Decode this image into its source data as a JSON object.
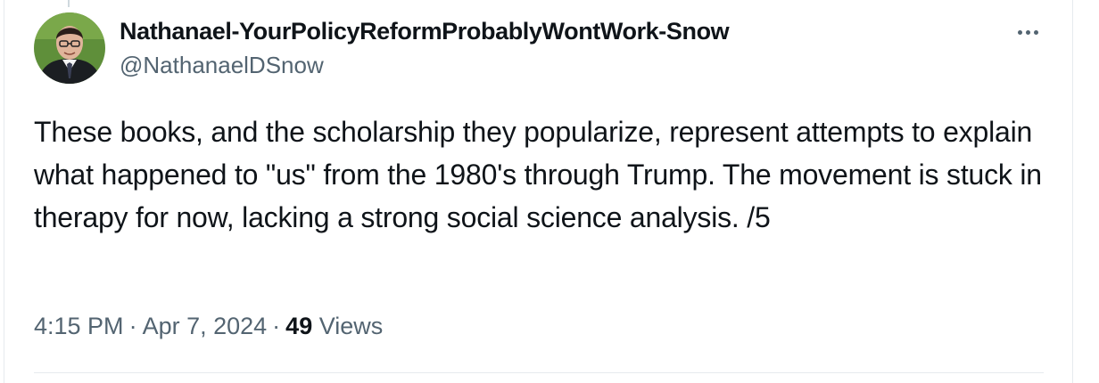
{
  "tweet": {
    "author": {
      "display_name": "Nathanael-YourPolicyReformProbablyWontWork-Snow",
      "handle": "@NathanaelDSnow",
      "avatar_icon": "profile-photo"
    },
    "more_icon": "more-horizontal-icon",
    "text": "These books, and the scholarship they popularize, represent attempts to explain what happened to \"us\" from the 1980's through Trump. The movement is stuck in therapy for now, lacking a strong social science analysis. /5",
    "time": "4:15 PM",
    "separator": "·",
    "date": "Apr 7, 2024",
    "views_count": "49",
    "views_label": "Views"
  },
  "colors": {
    "primary_text": "#0f1419",
    "secondary_text": "#536471",
    "divider": "#e6eaee"
  }
}
